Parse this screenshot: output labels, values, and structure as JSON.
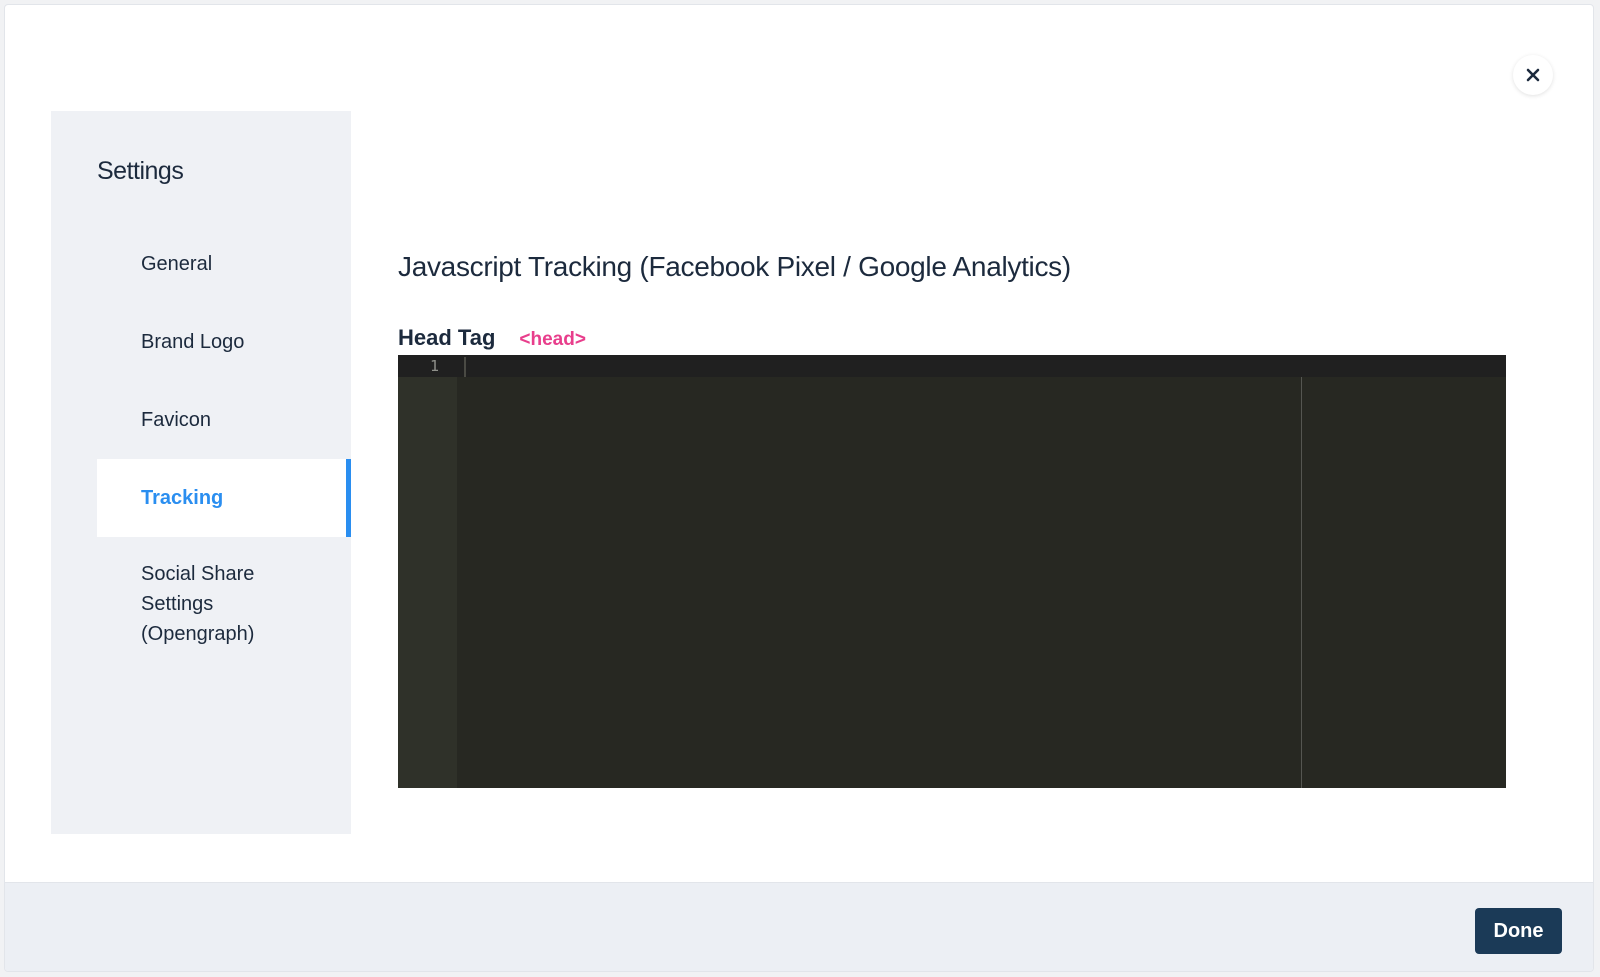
{
  "modal": {
    "close_icon": "close-icon"
  },
  "sidebar": {
    "title": "Settings",
    "items": [
      {
        "label": "General",
        "active": false
      },
      {
        "label": "Brand Logo",
        "active": false
      },
      {
        "label": "Favicon",
        "active": false
      },
      {
        "label": "Tracking",
        "active": true
      },
      {
        "label": "Social Share Settings (Opengraph)",
        "active": false
      }
    ]
  },
  "main": {
    "title": "Javascript Tracking (Facebook Pixel / Google Analytics)",
    "head_field": {
      "label": "Head Tag",
      "tag_hint": "<head>",
      "value": "",
      "line_numbers": [
        "1"
      ]
    }
  },
  "footer": {
    "done_label": "Done"
  },
  "colors": {
    "accent": "#2a8ef0",
    "tag_hint": "#e83e8c",
    "done_button": "#1b3a57",
    "editor_bg": "#272822"
  }
}
